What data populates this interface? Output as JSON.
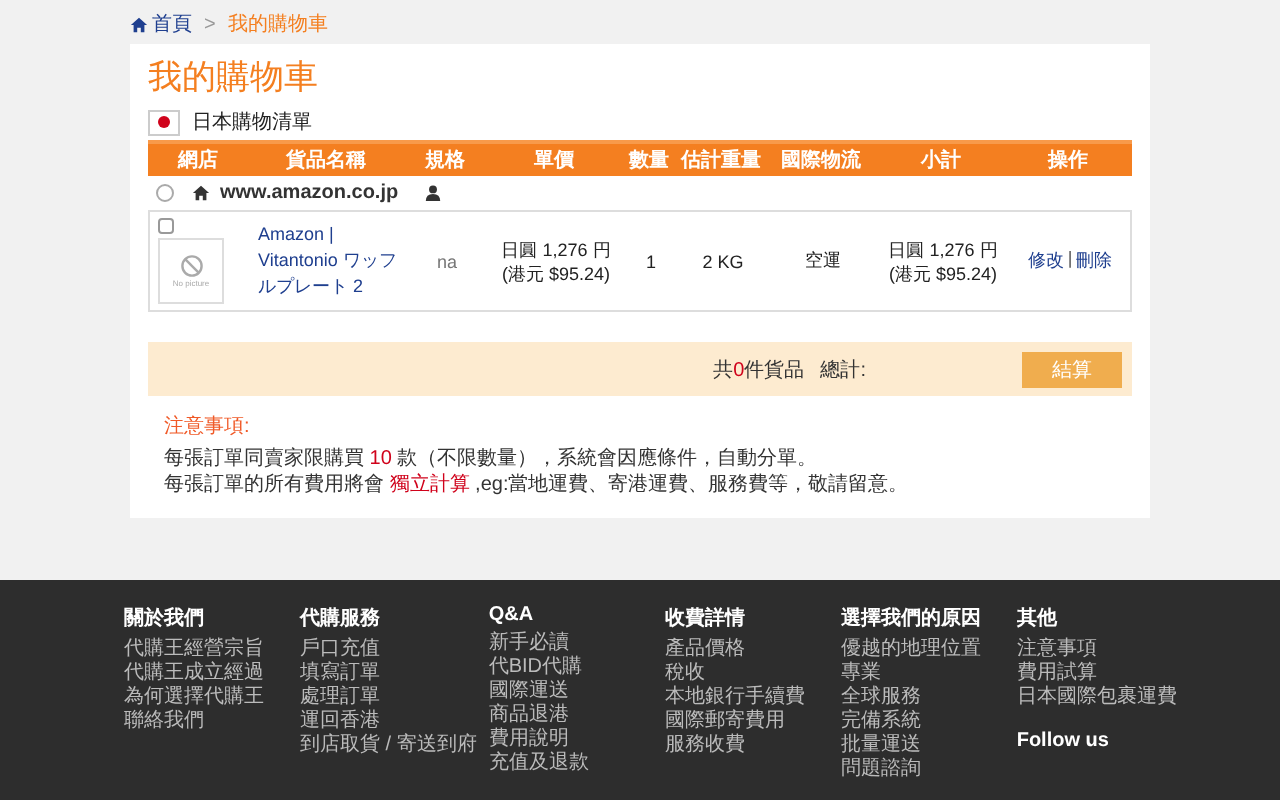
{
  "breadcrumb": {
    "home": "首頁",
    "separator": ">",
    "current": "我的購物車"
  },
  "page_title": "我的購物車",
  "cart": {
    "region": "日本購物清單",
    "columns": [
      "網店",
      "貨品名稱",
      "規格",
      "單價",
      "數量",
      "估計重量",
      "國際物流",
      "小計",
      "操作"
    ],
    "stores": [
      {
        "name": "www.amazon.co.jp",
        "selected": false,
        "items": [
          {
            "checked": false,
            "image_text": "No picture",
            "name": "Amazon | Vitantonio ワッフルプレート 2",
            "spec": "na",
            "price": "日圓 1,276 円",
            "price_hkd": "(港元 $95.24)",
            "qty": "1",
            "weight": "2 KG",
            "shipping": "空運",
            "subtotal": "日圓 1,276 円",
            "subtotal_hkd": "(港元 $95.24)",
            "actions": [
              "修改",
              "刪除"
            ],
            "action_separator": "|"
          }
        ]
      }
    ]
  },
  "summary": {
    "prefix": "共",
    "count": "0",
    "suffix": "件貨品",
    "total_label": "總計:",
    "checkout": "結算"
  },
  "notes": {
    "title": "注意事項:",
    "lines": [
      [
        {
          "text": "每張訂單同賣家限購買 ",
          "highlight": false
        },
        {
          "text": "10",
          "highlight": true
        },
        {
          "text": " 款（不限數量），系統會因應條件，自動分單。",
          "highlight": false
        }
      ],
      [
        {
          "text": "每張訂單的所有費用將會 ",
          "highlight": false
        },
        {
          "text": "獨立計算",
          "highlight": true
        },
        {
          "text": " ,eg:當地運費、寄港運費、服務費等，敬請留意。",
          "highlight": false
        }
      ]
    ]
  },
  "footer": {
    "columns": [
      {
        "title": "關於我們",
        "links": [
          "代購王經營宗旨",
          "代購王成立經過",
          "為何選擇代購王",
          "聯絡我們"
        ]
      },
      {
        "title": "代購服務",
        "links": [
          "戶口充值",
          "填寫訂單",
          "處理訂單",
          "運回香港",
          "到店取貨 / 寄送到府"
        ]
      },
      {
        "title": "Q&A",
        "links": [
          "新手必讀",
          "代BID代購",
          "國際運送",
          "商品退港",
          "費用說明",
          "充值及退款"
        ]
      },
      {
        "title": "收費詳情",
        "links": [
          "產品價格",
          "稅收",
          "本地銀行手續費",
          "國際郵寄費用",
          "服務收費"
        ]
      },
      {
        "title": "選擇我們的原因",
        "links": [
          "優越的地理位置",
          "專業",
          "全球服務",
          "完備系統",
          "批量運送",
          "問題諮詢"
        ]
      },
      {
        "title": "其他",
        "links": [
          "注意事項",
          "費用試算",
          "日本國際包裹運費"
        ],
        "extra": "Follow us"
      }
    ]
  }
}
